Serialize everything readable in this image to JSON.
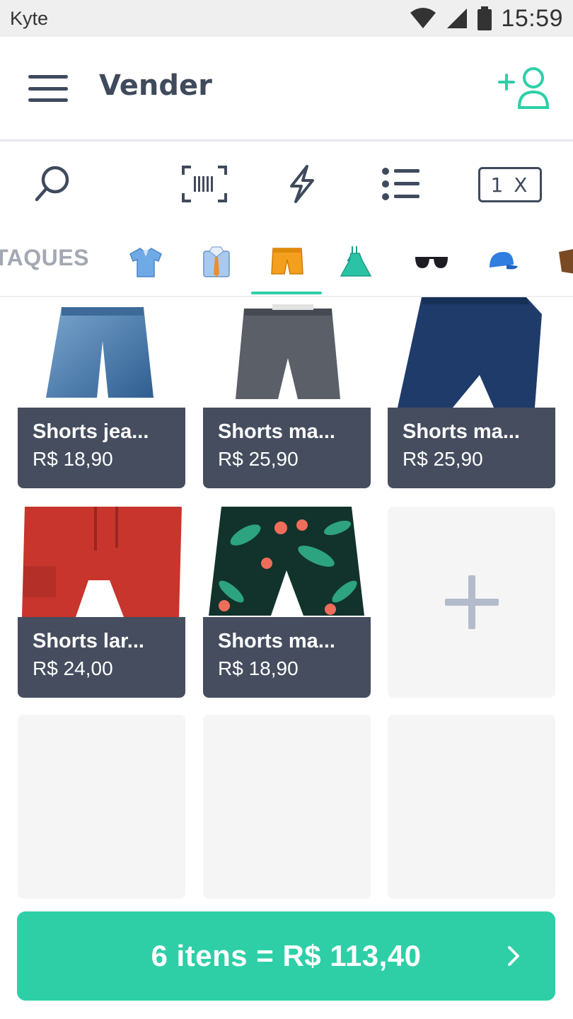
{
  "status_bar": {
    "app_name": "Kyte",
    "time": "15:59"
  },
  "header": {
    "title": "Vender"
  },
  "toolbar": {
    "quantity_multiplier": "1 X"
  },
  "tabs": {
    "highlights_label": "TAQUES",
    "categories": [
      {
        "icon": "polo-shirt-icon"
      },
      {
        "icon": "dress-shirt-tie-icon"
      },
      {
        "icon": "shorts-icon",
        "selected": true
      },
      {
        "icon": "dress-icon"
      },
      {
        "icon": "sunglasses-icon"
      },
      {
        "icon": "cap-icon"
      },
      {
        "icon": "shoe-icon"
      }
    ]
  },
  "products": [
    {
      "name": "Shorts jea...",
      "price": "R$ 18,90",
      "image": "denim-shorts"
    },
    {
      "name": "Shorts ma...",
      "price": "R$ 25,90",
      "image": "gray-shorts"
    },
    {
      "name": "Shorts ma...",
      "price": "R$ 25,90",
      "image": "navy-shorts"
    },
    {
      "name": "Shorts lar...",
      "price": "R$ 24,00",
      "image": "red-shorts"
    },
    {
      "name": "Shorts ma...",
      "price": "R$ 18,90",
      "image": "floral-shorts"
    }
  ],
  "checkout": {
    "label": "6 itens = R$ 113,40"
  },
  "colors": {
    "accent": "#2ecfa7",
    "dark": "#3f4a5c",
    "card": "#454d5f",
    "muted": "#a3a8b2"
  }
}
